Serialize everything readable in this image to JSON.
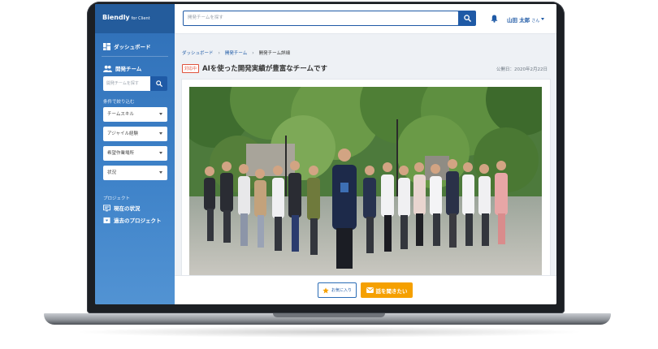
{
  "app": {
    "brand_name": "Biendly",
    "brand_suffix": "for Client"
  },
  "sidebar": {
    "dashboard_label": "ダッシュボード",
    "team_label": "開発チーム",
    "team_search_placeholder": "開発チームを探す",
    "filter_label": "条件で絞り込む",
    "filters": [
      "チームスキル",
      "アジャイル経験",
      "希望作業場所",
      "状況"
    ],
    "project_label": "プロジェクト",
    "current_status_label": "現在の状況",
    "past_projects_label": "過去のプロジェクト"
  },
  "header": {
    "search_placeholder": "開発チームを探す",
    "user_name": "山田 太郎",
    "user_suffix": "さん"
  },
  "breadcrumb": [
    "ダッシュボード",
    "開発チーム",
    "開発チーム詳細"
  ],
  "main": {
    "status_badge": "対応中",
    "title": "AIを使った開発実績が豊富なチームです",
    "published_date": "公開日：2020年2月22日"
  },
  "footer": {
    "favorite_label": "お気に入り",
    "contact_label": "話を聞きたい"
  },
  "colors": {
    "primary": "#1f5aa6",
    "sidebar": "#3a7dc4",
    "accent_orange": "#f5a000",
    "badge_red": "#e0533d"
  },
  "icons": {
    "dashboard": "dashboard-icon",
    "team": "people-icon",
    "search": "search-icon",
    "notification": "bell-icon",
    "current_status": "screen-icon",
    "past_projects": "archive-icon",
    "favorite": "star-icon",
    "contact": "mail-icon"
  }
}
